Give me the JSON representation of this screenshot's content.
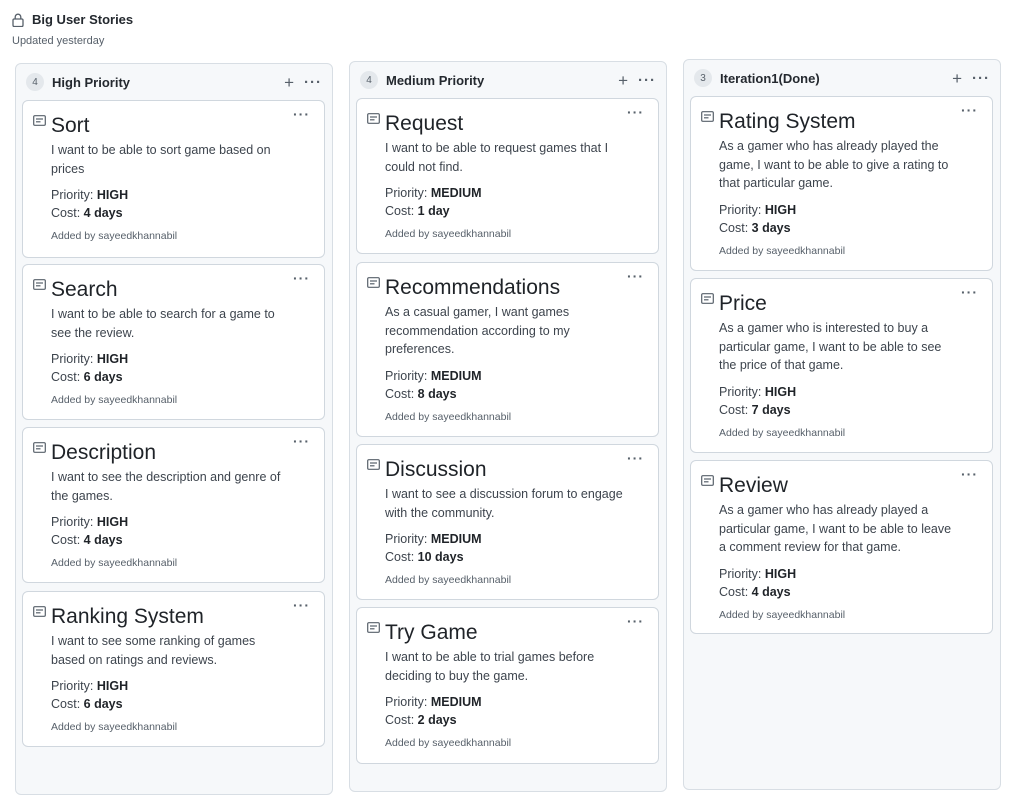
{
  "project": {
    "title": "Big User Stories",
    "updated": "Updated yesterday"
  },
  "labels": {
    "priority": "Priority:",
    "cost": "Cost:",
    "added_by": "Added by"
  },
  "icons": {
    "lock": "lock-icon",
    "note": "note-icon",
    "add": "plus-icon",
    "menu": "more-dots-icon"
  },
  "columns": [
    {
      "count": "4",
      "name": "High Priority",
      "cards": [
        {
          "title": "Sort",
          "desc": "I want to be able to sort game based on prices",
          "priority": "HIGH",
          "cost": "4 days",
          "author": "sayeedkhannabil"
        },
        {
          "title": "Search",
          "desc": "I want to be able to search for a game to see the review.",
          "priority": "HIGH",
          "cost": "6 days",
          "author": "sayeedkhannabil"
        },
        {
          "title": "Description",
          "desc": "I want to see the description and genre of the games.",
          "priority": "HIGH",
          "cost": "4 days",
          "author": "sayeedkhannabil"
        },
        {
          "title": "Ranking System",
          "desc": "I want to see some ranking of games based on ratings and reviews.",
          "priority": "HIGH",
          "cost": "6 days",
          "author": "sayeedkhannabil"
        }
      ]
    },
    {
      "count": "4",
      "name": "Medium Priority",
      "cards": [
        {
          "title": "Request",
          "desc": "I want to be able to request games that I could not find.",
          "priority": "MEDIUM",
          "cost": "1 day",
          "author": "sayeedkhannabil"
        },
        {
          "title": "Recommendations",
          "desc": "As a casual gamer, I want games recommendation according to my preferences.",
          "priority": "MEDIUM",
          "cost": "8 days",
          "author": "sayeedkhannabil"
        },
        {
          "title": "Discussion",
          "desc": "I want to see a discussion forum to engage with the community.",
          "priority": "MEDIUM",
          "cost": "10 days",
          "author": "sayeedkhannabil"
        },
        {
          "title": "Try Game",
          "desc": "I want to be able to trial games before deciding to buy the game.",
          "priority": "MEDIUM",
          "cost": "2 days",
          "author": "sayeedkhannabil"
        }
      ]
    },
    {
      "count": "3",
      "name": "Iteration1(Done)",
      "cards": [
        {
          "title": "Rating System",
          "desc": "As a gamer who has already played the game, I want to be able to give a rating to that particular game.",
          "priority": "HIGH",
          "cost": "3 days",
          "author": "sayeedkhannabil"
        },
        {
          "title": "Price",
          "desc": "As a gamer who is interested to buy a particular game, I want to be able to see the price of that game.",
          "priority": "HIGH",
          "cost": "7 days",
          "author": "sayeedkhannabil"
        },
        {
          "title": "Review",
          "desc": "As a gamer who has already played a particular game, I want to be able to leave a comment review for that game.",
          "priority": "HIGH",
          "cost": "4 days",
          "author": "sayeedkhannabil"
        }
      ]
    }
  ]
}
